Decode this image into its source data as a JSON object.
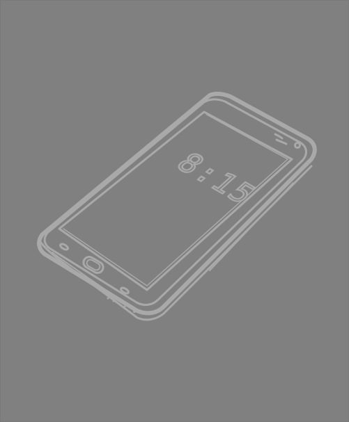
{
  "illustration": {
    "subject": "hand-drawn-smartphone",
    "screen_time": "8:15",
    "colors": {
      "background": "#808080",
      "line": "#a9a9a9"
    }
  }
}
